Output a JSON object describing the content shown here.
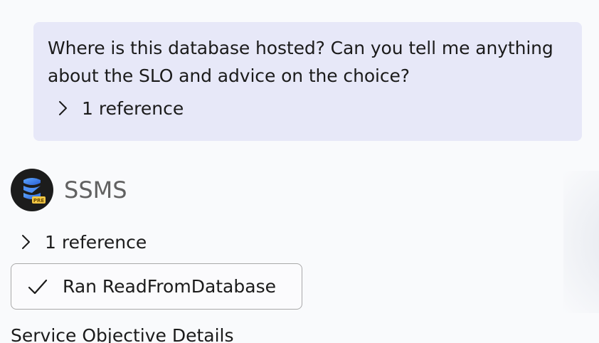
{
  "user_message": {
    "text": "Where is this database hosted? Can you tell me anything about the SLO and advice on the choice?",
    "reference_label": "1 reference"
  },
  "assistant": {
    "name": "SSMS",
    "avatar_badge": "PRE",
    "reference_label": "1 reference",
    "tool_call_label": "Ran ReadFromDatabase",
    "section_heading": "Service Objective Details"
  },
  "colors": {
    "bubble_bg": "#e7e8f8",
    "page_bg": "#f9fafc",
    "avatar_bg": "#1c1c1c",
    "badge": "#f2c744",
    "logo_blue": "#3b7bf0"
  },
  "icons": {
    "expand": "chevron-right-icon",
    "status": "checkmark-icon",
    "avatar": "ssms-logo-icon"
  }
}
